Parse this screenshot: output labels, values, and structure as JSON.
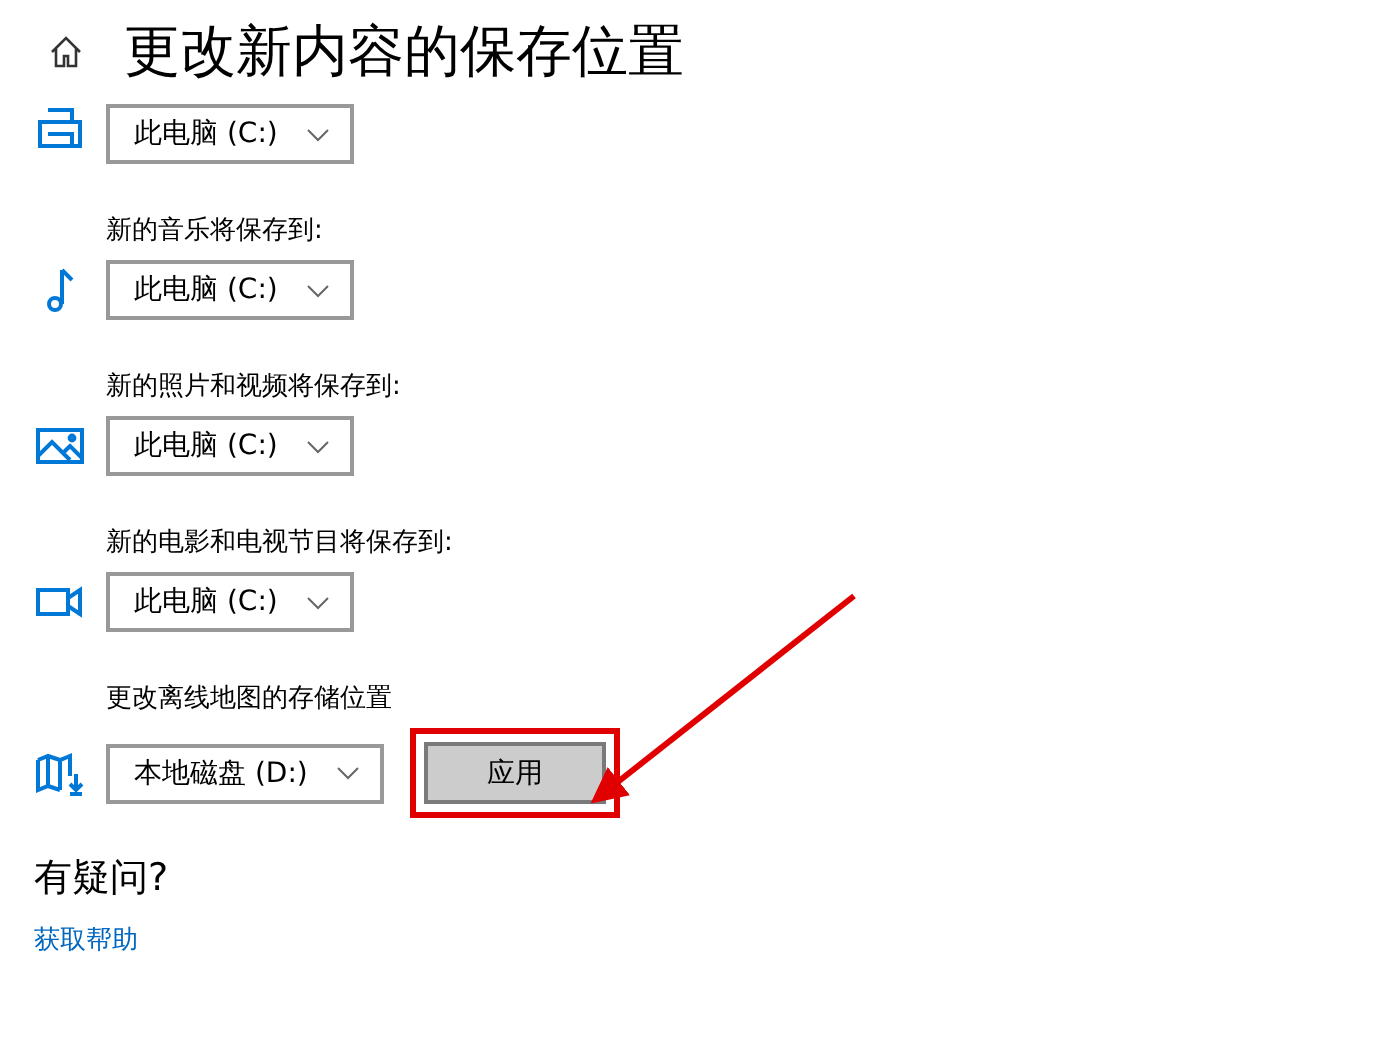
{
  "page": {
    "title": "更改新内容的保存位置"
  },
  "locations": [
    {
      "kind": "document",
      "value": "此电脑 (C:)"
    },
    {
      "kind": "music",
      "label": "新的音乐将保存到:",
      "value": "此电脑 (C:)"
    },
    {
      "kind": "photo",
      "label": "新的照片和视频将保存到:",
      "value": "此电脑 (C:)"
    },
    {
      "kind": "video",
      "label": "新的电影和电视节目将保存到:",
      "value": "此电脑 (C:)"
    },
    {
      "kind": "map",
      "label": "更改离线地图的存储位置",
      "value": "本地磁盘 (D:)",
      "button": "应用"
    }
  ],
  "help": {
    "heading": "有疑问?",
    "link": "获取帮助"
  }
}
